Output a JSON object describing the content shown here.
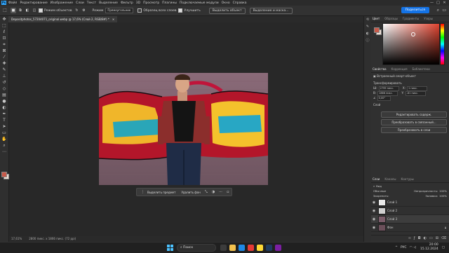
{
  "app": {
    "logo": "Ps",
    "menu": [
      "Файл",
      "Редактирование",
      "Изображение",
      "Слои",
      "Текст",
      "Выделение",
      "Фильтр",
      "3D",
      "Просмотр",
      "Плагины",
      "Подключаемые модули",
      "Окно",
      "Справка"
    ],
    "window_controls": [
      "—",
      "□",
      "✕"
    ]
  },
  "options_bar": {
    "sample_all_layers_label": "Режим объектов",
    "mode_label": "Режим",
    "mode_value": "Прямоугольник",
    "all_layers_label": "Образец всех слоев",
    "auto_enhance_label": "Улучшить",
    "select_subject_label": "Выделить объект",
    "select_and_mask_label": "Выделение и маска...",
    "share_label": "Поделиться"
  },
  "document": {
    "tab_title": "Depositphotos_57204071_original.webp @ 17,6% (Слой 2, RGB/8#) *",
    "close": "×"
  },
  "contextual_taskbar": {
    "select_subject": "Выделить предмет",
    "remove_bg": "Удалить фон"
  },
  "status": {
    "zoom": "17,61%",
    "doc_info": "2800 пикс. х 1866 пикс. (72 ppi)"
  },
  "color_panel": {
    "tabs": [
      "Цвет",
      "Образцы",
      "Градиенты",
      "Узоры"
    ],
    "fg_color": "#c85a4a",
    "bg_color": "#efe0d6"
  },
  "properties_panel": {
    "tabs": [
      "Свойства",
      "Коррекция",
      "Библиотеки"
    ],
    "kind": "Встроенный смарт-объект",
    "transform_label": "Трансформировать",
    "w_label": "Ш:",
    "w_value": "2799 пикс.",
    "x_label": "X:",
    "x_value": "1 пикс.",
    "h_label": "В:",
    "h_value": "1866 пикс.",
    "y_label": "Y:",
    "y_value": "-81 пикс.",
    "angle_value": "0,00°",
    "layer_comp_label": "Слой",
    "btn_edit": "Редактировать содерж.",
    "btn_convert": "Преобразовать в связанный...",
    "btn_layers": "Преобразовать в слои"
  },
  "layers_panel": {
    "tabs": [
      "Слои",
      "Каналы",
      "Контуры"
    ],
    "filter_label": "Вид",
    "blend_mode": "Обычные",
    "opacity_label": "Непрозрачность:",
    "opacity_value": "100%",
    "lock_label": "Закрепить:",
    "fill_label": "Заливка:",
    "fill_value": "100%",
    "layers": [
      {
        "name": "Слой 1",
        "selected": false
      },
      {
        "name": "Слой 2",
        "selected": false
      },
      {
        "name": "Слой 3",
        "selected": true
      },
      {
        "name": "Фон",
        "selected": false
      }
    ]
  },
  "taskbar": {
    "search_placeholder": "Поиск",
    "lang": "РУС",
    "time": "20:00",
    "date": "15.12.2024"
  }
}
